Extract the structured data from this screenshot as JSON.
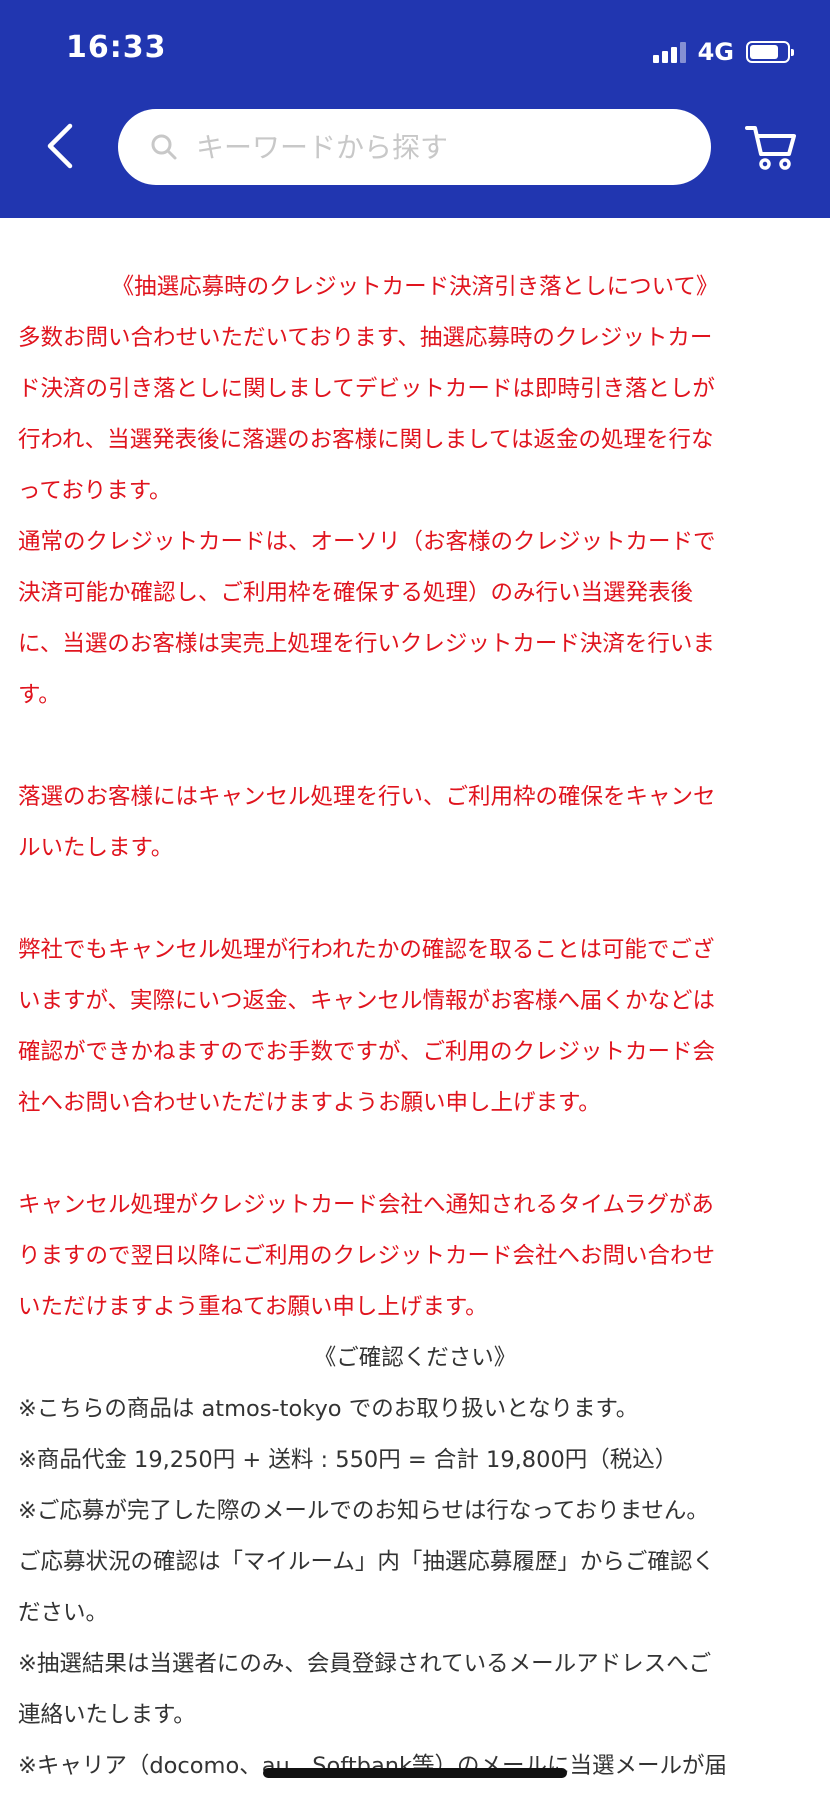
{
  "status_bar": {
    "time": "16:33",
    "network": "4G"
  },
  "header": {
    "background_color": "#2136b0",
    "search_placeholder": "キーワードから探す"
  },
  "notice": {
    "color": "#e0141e",
    "title": "《抽選応募時のクレジットカード決済引き落としについて》",
    "para1": [
      "多数お問い合わせいただいております、抽選応募時のクレジットカー",
      "ド決済の引き落としに関しましてデビットカードは即時引き落としが",
      "行われ、当選発表後に落選のお客様に関しましては返金の処理を行な",
      "っております。"
    ],
    "para2": [
      "通常のクレジットカードは、オーソリ（お客様のクレジットカードで",
      "決済可能か確認し、ご利用枠を確保する処理）のみ行い当選発表後",
      "に、当選のお客様は実売上処理を行いクレジットカード決済を行いま",
      "す。"
    ],
    "para3": [
      "落選のお客様にはキャンセル処理を行い、ご利用枠の確保をキャンセ",
      "ルいたします。"
    ],
    "para4": [
      "弊社でもキャンセル処理が行われたかの確認を取ることは可能でござ",
      "いますが、実際にいつ返金、キャンセル情報がお客様へ届くかなどは",
      "確認ができかねますのでお手数ですが、ご利用のクレジットカード会",
      "社へお問い合わせいただけますようお願い申し上げます。"
    ],
    "para5": [
      "キャンセル処理がクレジットカード会社へ通知されるタイムラグがあ",
      "りますので翌日以降にご利用のクレジットカード会社へお問い合わせ",
      "いただけますよう重ねてお願い申し上げます。"
    ]
  },
  "confirm": {
    "title": "《ご確認ください》",
    "lines": [
      "※こちらの商品は atmos-tokyo でのお取り扱いとなります。",
      "※商品代金 19,250円 + 送料 : 550円 = 合計 19,800円（税込）",
      "※ご応募が完了した際のメールでのお知らせは行なっておりません。",
      "ご応募状況の確認は「マイルーム」内「抽選応募履歴」からご確認く",
      "ださい。",
      "※抽選結果は当選者にのみ、会員登録されているメールアドレスへご",
      "連絡いたします。",
      "※キャリア（docomo、au、Softbank等）のメールに当選メールが届"
    ]
  }
}
